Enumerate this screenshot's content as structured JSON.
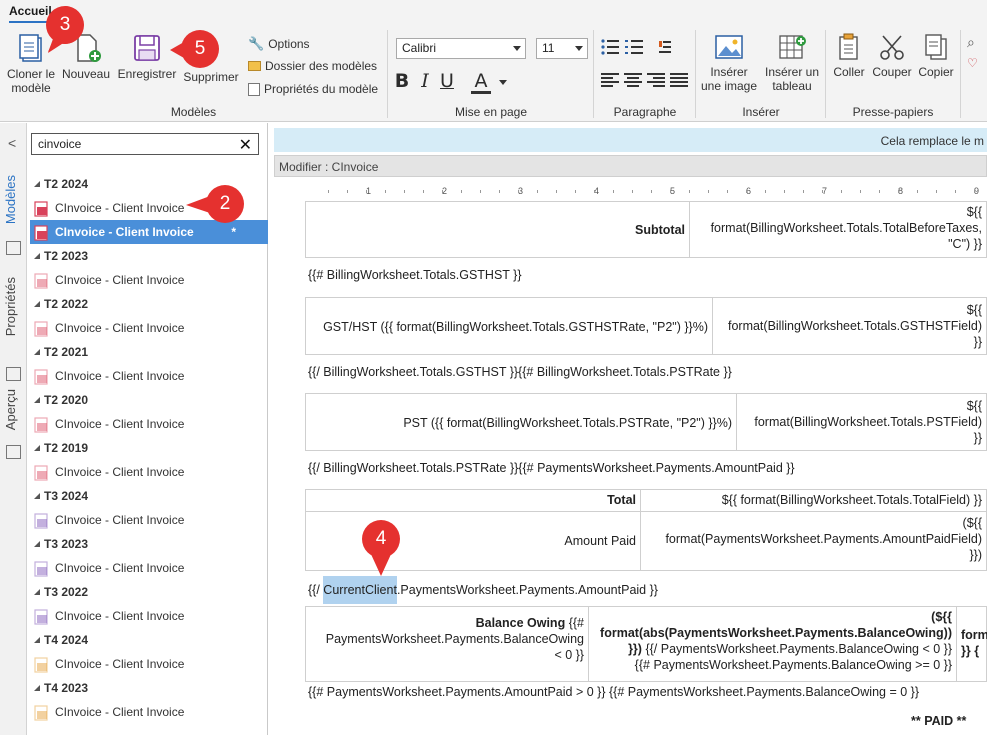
{
  "ribbon": {
    "tab": "Accueil",
    "groups": {
      "modeles": "Modèles",
      "mise_en_page": "Mise en page",
      "paragraphe": "Paragraphe",
      "inserer": "Insérer",
      "presse_papiers": "Presse-papiers"
    },
    "buttons": {
      "cloner_l1": "Cloner le",
      "cloner_l2": "modèle",
      "nouveau": "Nouveau",
      "enregistrer": "Enregistrer",
      "supprimer": "Supprimer",
      "options": "Options",
      "dossier": "Dossier des modèles",
      "proprietes": "Propriétés du modèle",
      "inserer_image_l1": "Insérer",
      "inserer_image_l2": "une image",
      "inserer_tableau_l1": "Insérer un",
      "inserer_tableau_l2": "tableau",
      "coller": "Coller",
      "couper": "Couper",
      "copier": "Copier"
    },
    "font": {
      "family": "Calibri",
      "size": "11"
    },
    "format": {
      "bold": "B",
      "italic": "I",
      "underline": "U",
      "color": "A"
    }
  },
  "sidebar": {
    "tabs": {
      "modeles": "Modèles",
      "proprietes": "Propriétés",
      "apercu": "Aperçu"
    },
    "search_value": "cinvoice",
    "tree": [
      {
        "type": "head",
        "label": "T2 2024"
      },
      {
        "type": "item",
        "label": "CInvoice - Client Invoice",
        "icon": "T2"
      },
      {
        "type": "item",
        "label": "CInvoice - Client Invoice",
        "icon": "T2",
        "selected": true,
        "marker": "*"
      },
      {
        "type": "head",
        "label": "T2 2023"
      },
      {
        "type": "item",
        "label": "CInvoice - Client Invoice",
        "icon": "T2"
      },
      {
        "type": "head",
        "label": "T2 2022"
      },
      {
        "type": "item",
        "label": "CInvoice - Client Invoice",
        "icon": "T2"
      },
      {
        "type": "head",
        "label": "T2 2021"
      },
      {
        "type": "item",
        "label": "CInvoice - Client Invoice",
        "icon": "T2"
      },
      {
        "type": "head",
        "label": "T2 2020"
      },
      {
        "type": "item",
        "label": "CInvoice - Client Invoice",
        "icon": "T2"
      },
      {
        "type": "head",
        "label": "T2 2019"
      },
      {
        "type": "item",
        "label": "CInvoice - Client Invoice",
        "icon": "T2"
      },
      {
        "type": "head",
        "label": "T3 2024"
      },
      {
        "type": "item",
        "label": "CInvoice - Client Invoice",
        "icon": "T3"
      },
      {
        "type": "head",
        "label": "T3 2023"
      },
      {
        "type": "item",
        "label": "CInvoice - Client Invoice",
        "icon": "T3"
      },
      {
        "type": "head",
        "label": "T3 2022"
      },
      {
        "type": "item",
        "label": "CInvoice - Client Invoice",
        "icon": "T3"
      },
      {
        "type": "head",
        "label": "T4 2024"
      },
      {
        "type": "item",
        "label": "CInvoice - Client Invoice",
        "icon": "T4"
      },
      {
        "type": "head",
        "label": "T4 2023"
      },
      {
        "type": "item",
        "label": "CInvoice - Client Invoice",
        "icon": "T4"
      }
    ]
  },
  "main": {
    "banner": "Cela remplace le m",
    "modifier": "Modifier : CInvoice",
    "ruler": [
      "1",
      "2",
      "3",
      "4",
      "5",
      "6",
      "7",
      "8",
      "9"
    ],
    "doc": {
      "subtotal_label": "Subtotal",
      "subtotal_l1": "${{",
      "subtotal_l2": "format(BillingWorksheet.Totals.TotalBeforeTaxes,",
      "subtotal_l3": "\"C\") }}",
      "gst_open": "{{# BillingWorksheet.Totals.GSTHST }}",
      "gst_label": "GST/HST ({{ format(BillingWorksheet.Totals.GSTHSTRate, \"P2\") }}%)",
      "gst_l1": "${{",
      "gst_l2": "format(BillingWorksheet.Totals.GSTHSTField)",
      "gst_l3": "}}",
      "gst_close_pst_open": "{{/ BillingWorksheet.Totals.GSTHST }}{{# BillingWorksheet.Totals.PSTRate }}",
      "pst_label": "PST ({{ format(BillingWorksheet.Totals.PSTRate, \"P2\") }}%)",
      "pst_l1": "${{",
      "pst_l2": "format(BillingWorksheet.Totals.PSTField)",
      "pst_l3": "}}",
      "pst_close_paid_open": "{{/ BillingWorksheet.Totals.PSTRate }}{{# PaymentsWorksheet.Payments.AmountPaid }}",
      "total_label": "Total",
      "total_value": "${{ format(BillingWorksheet.Totals.TotalField) }}",
      "amount_paid_label": "Amount Paid",
      "amount_paid_l1": "(${{",
      "amount_paid_l2": "format(PaymentsWorksheet.Payments.AmountPaidField)",
      "amount_paid_l3": "}})",
      "close_prefix": "{{/ ",
      "close_highlight": "CurrentClient",
      "close_suffix": ".PaymentsWorksheet.Payments.AmountPaid }}",
      "balance_label": "Balance Owing",
      "balance_label2": "{{#",
      "balance_label3": "PaymentsWorksheet.Payments.BalanceOwing",
      "balance_label4": "< 0 }}",
      "balance_v1": "(${{",
      "balance_v2": "format(abs(PaymentsWorksheet.Payments.BalanceOwing))",
      "balance_v3": "}})",
      "balance_v3b": "{{/ PaymentsWorksheet.Payments.BalanceOwing < 0 }}",
      "balance_v4": "{{# PaymentsWorksheet.Payments.BalanceOwing >= 0 }}",
      "balance_c1": "form",
      "balance_c2": "}} {",
      "final_line": "{{# PaymentsWorksheet.Payments.AmountPaid > 0 }} {{# PaymentsWorksheet.Payments.BalanceOwing = 0 }}",
      "paid": "** PAID **"
    }
  },
  "callouts": [
    "3",
    "5",
    "2",
    "4"
  ],
  "colors": {
    "callout": "#e5312f",
    "selection": "#4a8fd9",
    "banner": "#d6ecf7",
    "highlight": "#b0d2ef"
  }
}
